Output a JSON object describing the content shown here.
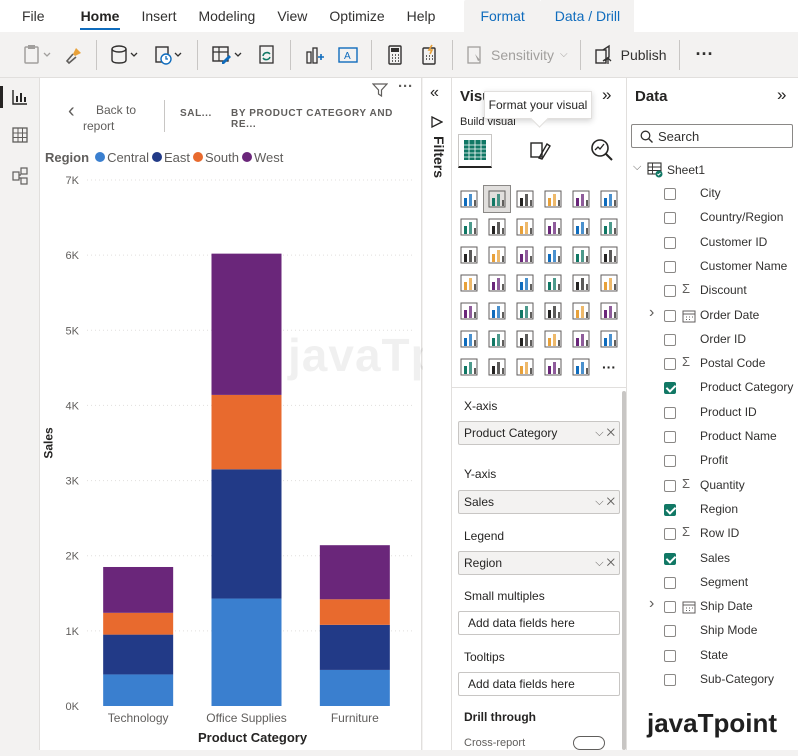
{
  "menu": {
    "file": "File",
    "home": "Home",
    "insert": "Insert",
    "modeling": "Modeling",
    "view": "View",
    "optimize": "Optimize",
    "help": "Help",
    "format": "Format",
    "data_drill": "Data / Drill"
  },
  "ribbon": {
    "sensitivity": "Sensitivity",
    "publish": "Publish",
    "more": "···"
  },
  "canvas": {
    "back_label_line1": "Back to",
    "back_label_line2": "report",
    "crumb1": "SAL...",
    "crumb2": "BY PRODUCT CATEGORY AND RE...",
    "more": "···"
  },
  "chart_data": {
    "type": "bar",
    "stacked": true,
    "categories": [
      "Technology",
      "Office Supplies",
      "Furniture"
    ],
    "series": [
      {
        "name": "Central",
        "color": "#3a7fcf",
        "values": [
          420,
          1430,
          480
        ]
      },
      {
        "name": "East",
        "color": "#223a87",
        "values": [
          530,
          1720,
          600
        ]
      },
      {
        "name": "South",
        "color": "#e86a2e",
        "values": [
          290,
          990,
          340
        ]
      },
      {
        "name": "West",
        "color": "#6a267a",
        "values": [
          610,
          1880,
          720
        ]
      }
    ],
    "xlabel": "Product Category",
    "ylabel": "Sales",
    "ylim": [
      0,
      7000
    ],
    "yticks": [
      "0K",
      "1K",
      "2K",
      "3K",
      "4K",
      "5K",
      "6K",
      "7K"
    ],
    "legend_title": "Region",
    "legend_position": "top-left",
    "grid": true
  },
  "filters": {
    "label": "Filters"
  },
  "viz_pane": {
    "title": "Visu",
    "build_visual": "Build visual",
    "tooltip": "Format your visual",
    "more": "···",
    "xaxis_label": "X-axis",
    "xaxis_value": "Product Category",
    "yaxis_label": "Y-axis",
    "yaxis_value": "Sales",
    "legend_label": "Legend",
    "legend_value": "Region",
    "small_multiples_label": "Small multiples",
    "small_multiples_placeholder": "Add data fields here",
    "tooltips_label": "Tooltips",
    "tooltips_placeholder": "Add data fields here",
    "drill_label": "Drill through",
    "cross_report": "Cross-report",
    "remove": "✕",
    "chevron": "⌵"
  },
  "data_pane": {
    "title": "Data",
    "search_placeholder": "Search",
    "table": "Sheet1",
    "fields": [
      {
        "name": "City",
        "checked": false,
        "sigma": false,
        "expand": false,
        "type": "text"
      },
      {
        "name": "Country/Region",
        "checked": false,
        "sigma": false,
        "expand": false,
        "type": "text"
      },
      {
        "name": "Customer ID",
        "checked": false,
        "sigma": false,
        "expand": false,
        "type": "text"
      },
      {
        "name": "Customer Name",
        "checked": false,
        "sigma": false,
        "expand": false,
        "type": "text"
      },
      {
        "name": "Discount",
        "checked": false,
        "sigma": true,
        "expand": false,
        "type": "number"
      },
      {
        "name": "Order Date",
        "checked": false,
        "sigma": false,
        "expand": true,
        "type": "date"
      },
      {
        "name": "Order ID",
        "checked": false,
        "sigma": false,
        "expand": false,
        "type": "text"
      },
      {
        "name": "Postal Code",
        "checked": false,
        "sigma": true,
        "expand": false,
        "type": "number"
      },
      {
        "name": "Product Category",
        "checked": true,
        "sigma": false,
        "expand": false,
        "type": "text"
      },
      {
        "name": "Product ID",
        "checked": false,
        "sigma": false,
        "expand": false,
        "type": "text"
      },
      {
        "name": "Product Name",
        "checked": false,
        "sigma": false,
        "expand": false,
        "type": "text"
      },
      {
        "name": "Profit",
        "checked": false,
        "sigma": false,
        "expand": false,
        "type": "text"
      },
      {
        "name": "Quantity",
        "checked": false,
        "sigma": true,
        "expand": false,
        "type": "number"
      },
      {
        "name": "Region",
        "checked": true,
        "sigma": false,
        "expand": false,
        "type": "text"
      },
      {
        "name": "Row ID",
        "checked": false,
        "sigma": true,
        "expand": false,
        "type": "number"
      },
      {
        "name": "Sales",
        "checked": true,
        "sigma": false,
        "expand": false,
        "type": "text"
      },
      {
        "name": "Segment",
        "checked": false,
        "sigma": false,
        "expand": false,
        "type": "text"
      },
      {
        "name": "Ship Date",
        "checked": false,
        "sigma": false,
        "expand": true,
        "type": "date"
      },
      {
        "name": "Ship Mode",
        "checked": false,
        "sigma": false,
        "expand": false,
        "type": "text"
      },
      {
        "name": "State",
        "checked": false,
        "sigma": false,
        "expand": false,
        "type": "text"
      },
      {
        "name": "Sub-Category",
        "checked": false,
        "sigma": false,
        "expand": false,
        "type": "text"
      }
    ]
  },
  "watermark_center": "javaTpoint",
  "watermark_brand": "javaTpoint"
}
